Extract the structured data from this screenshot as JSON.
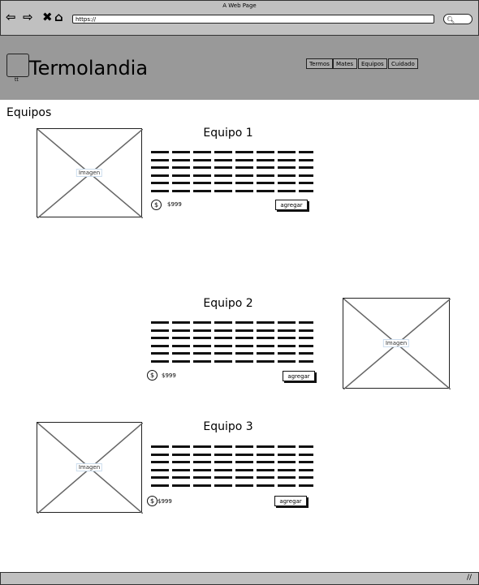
{
  "browser": {
    "title": "A Web Page",
    "url": "https://",
    "search_icon": "search-icon"
  },
  "header": {
    "brand": "Termolandia",
    "logo_caption": "tt",
    "menu": [
      "Termos",
      "Mates",
      "Equipos",
      "Cuidado"
    ]
  },
  "section_title": "Equipos",
  "image_label": "Imagen",
  "products": [
    {
      "title": "Equipo 1",
      "price": "$999",
      "button": "agregar"
    },
    {
      "title": "Equipo 2",
      "price": "$999",
      "button": "agregar"
    },
    {
      "title": "Equipo 3",
      "price": "$999",
      "button": "agregar"
    }
  ],
  "currency_symbol": "$"
}
